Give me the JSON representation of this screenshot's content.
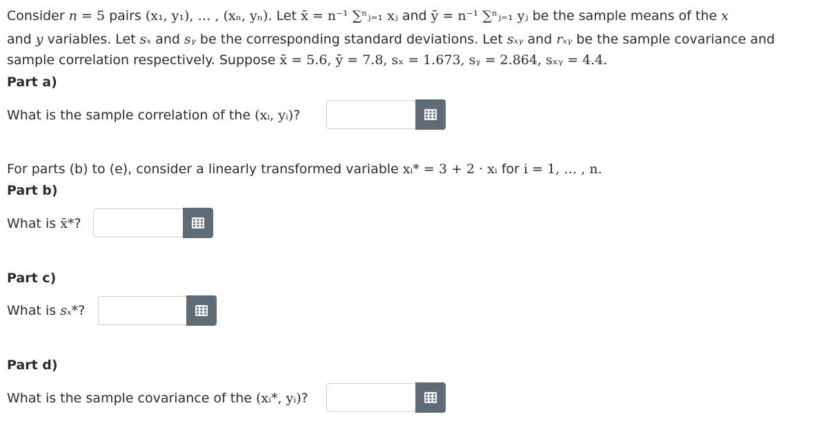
{
  "intro": {
    "l1_a": "Consider ",
    "l1_n": "n",
    "l1_eq5": " = 5",
    "l1_b": " pairs ",
    "l1_pairs": "(x₁, y₁), … , (xₙ, yₙ).",
    "l1_c": " Let ",
    "l1_xbar_def": "x̄ = n⁻¹ ∑ⁿⱼ₌₁ xⱼ",
    "l1_d": " and ",
    "l1_ybar_def": "ȳ = n⁻¹ ∑ⁿⱼ₌₁ yⱼ",
    "l1_e": " be the sample means of the ",
    "l1_x": "x",
    "l2_a": "and ",
    "l2_y": "y",
    "l2_b": " variables. Let ",
    "l2_sx": "sₓ",
    "l2_c": " and ",
    "l2_sy": "sᵧ",
    "l2_d": " be the corresponding standard deviations. Let ",
    "l2_sxy": "sₓᵧ",
    "l2_e": " and ",
    "l2_rxy": "rₓᵧ",
    "l2_f": " be the sample covariance and",
    "l3_a": "sample correlation respectively. Suppose ",
    "l3_vals": "x̄ = 5.6, ȳ = 7.8, sₓ = 1.673, sᵧ = 2.864, sₓᵧ = 4.4."
  },
  "part_a": {
    "title": "Part a)",
    "q_prefix": "What is the sample correlation of the ",
    "q_math": "(xᵢ, yᵢ)",
    "q_suffix": "?",
    "input_value": ""
  },
  "transform": {
    "prefix": "For parts (b) to (e), consider a linearly transformed variable ",
    "math": "xᵢ* = 3 + 2 · xᵢ",
    "mid": " for ",
    "range": "i = 1, … , n."
  },
  "part_b": {
    "title": "Part b)",
    "q_prefix": "What is ",
    "q_math": "x̄*",
    "q_suffix": "?",
    "input_value": ""
  },
  "part_c": {
    "title": "Part c)",
    "q_prefix": "What is ",
    "q_math": "sₓ*",
    "q_suffix": "?",
    "input_value": ""
  },
  "part_d": {
    "title": "Part d)",
    "q_prefix": "What is the sample covariance of the ",
    "q_math": "(xᵢ*, yᵢ)",
    "q_suffix": "?",
    "input_value": ""
  },
  "icons": {
    "keyboard": "keyboard-icon"
  },
  "colors": {
    "button_bg": "#5f6b76",
    "text": "#2b2b2b",
    "input_border": "#cfcfcf"
  }
}
